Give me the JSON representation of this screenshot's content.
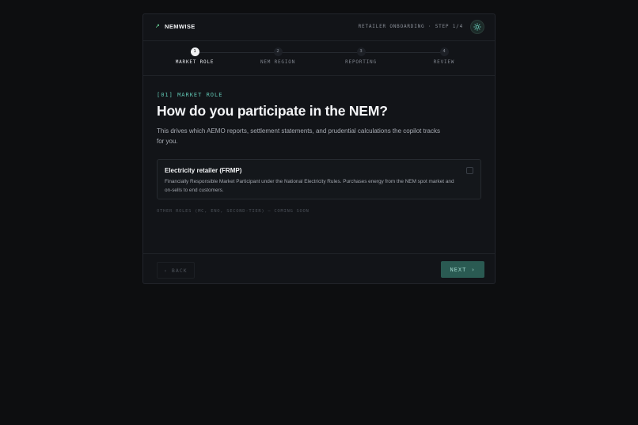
{
  "header": {
    "brand": "NEMWISE",
    "crumb": "RETAILER ONBOARDING · STEP 1/4",
    "theme_icon": "sun-icon"
  },
  "stepper": {
    "steps": [
      {
        "number": "1",
        "label": "MARKET ROLE",
        "active": true
      },
      {
        "number": "2",
        "label": "NEM REGION",
        "active": false
      },
      {
        "number": "3",
        "label": "REPORTING",
        "active": false
      },
      {
        "number": "4",
        "label": "REVIEW",
        "active": false
      }
    ]
  },
  "main": {
    "eyebrow": "[01] MARKET ROLE",
    "title": "How do you participate in the NEM?",
    "subtitle": "This drives which AEMO reports, settlement statements, and prudential calculations the copilot tracks for you.",
    "option": {
      "title": "Electricity retailer (FRMP)",
      "description": "Financially Responsible Market Participant under the National Electricity Rules. Purchases energy from the NEM spot market and on-sells to end customers.",
      "checked": false
    },
    "other_roles": "OTHER ROLES (MC, ENO, SECOND-TIER) — COMING SOON"
  },
  "footer": {
    "back_label": "BACK",
    "back_icon": "‹",
    "next_label": "NEXT",
    "next_icon": "›"
  },
  "colors": {
    "accent": "#5fc3b0",
    "next_button": "#2a5a52",
    "background": "#0d0e10",
    "card": "#121418"
  }
}
